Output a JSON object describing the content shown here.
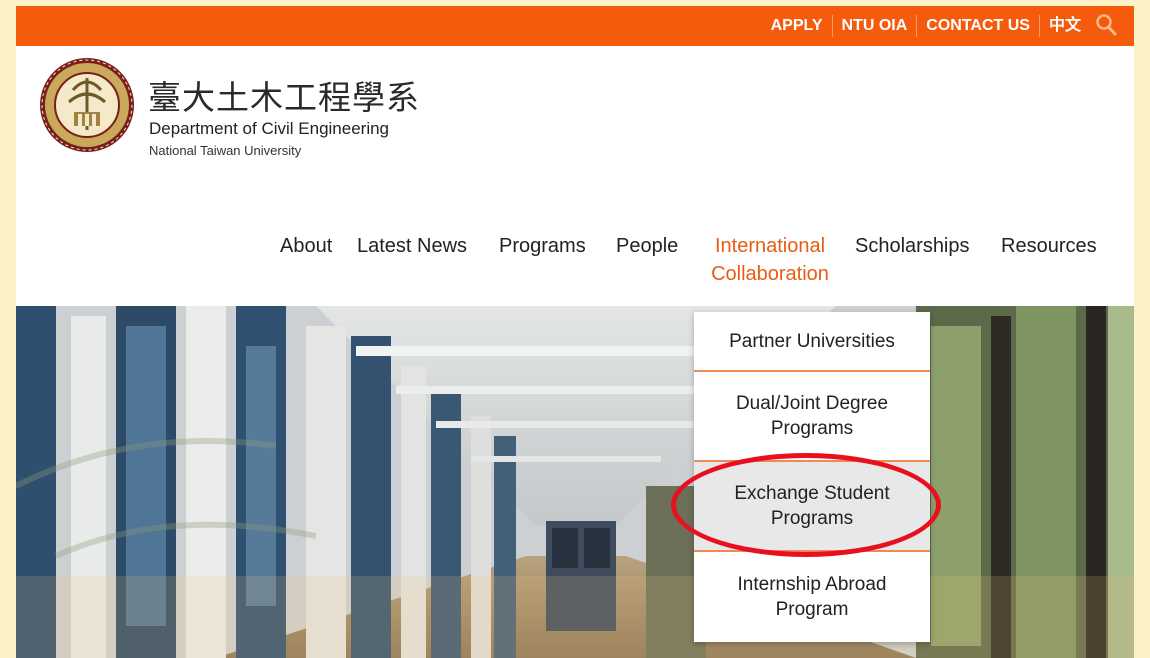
{
  "topbar": {
    "links": [
      "APPLY",
      "NTU OIA",
      "CONTACT US",
      "中文"
    ],
    "search_icon": "search-icon",
    "bg_color": "#f55b0c"
  },
  "header": {
    "title_zh": "臺大土木工程學系",
    "title_en": "Department of Civil Engineering",
    "subtitle": "National Taiwan University",
    "logo_icon": "ntu-seal-icon"
  },
  "nav": {
    "items": [
      "About",
      "Latest News",
      "Programs",
      "People",
      "International",
      "Collaboration",
      "Scholarships",
      "Resources"
    ],
    "active_color": "#e85c14"
  },
  "dropdown": {
    "items": [
      [
        "Partner Universities"
      ],
      [
        "Dual/Joint Degree",
        "Programs"
      ],
      [
        "Exchange Student",
        "Programs"
      ],
      [
        "Internship Abroad",
        "Program"
      ]
    ],
    "highlighted_color": "#e8101e"
  }
}
